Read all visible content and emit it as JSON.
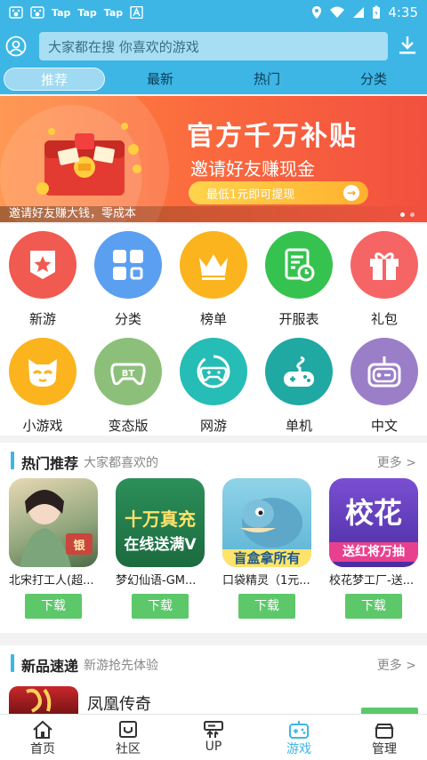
{
  "status_bar": {
    "tap_labels": [
      "Tap",
      "Tap",
      "Tap"
    ],
    "time": "4:35"
  },
  "header": {
    "search_placeholder": "大家都在搜  你喜欢的游戏",
    "tabs": [
      "推荐",
      "最新",
      "热门",
      "分类"
    ],
    "active_tab": "推荐",
    "accent_color": "#3db6e6"
  },
  "banner": {
    "title": "官方千万补贴",
    "subtitle": "邀请好友赚现金",
    "button_label": "最低1元即可提现",
    "caption": "邀请好友赚大钱，零成本",
    "slide_count": 2
  },
  "categories": [
    {
      "label": "新游",
      "icon": "star-badge-icon",
      "color": "#f05a50"
    },
    {
      "label": "分类",
      "icon": "grid-icon",
      "color": "#5b9ff0"
    },
    {
      "label": "榜单",
      "icon": "crown-icon",
      "color": "#fbb31e"
    },
    {
      "label": "开服表",
      "icon": "server-schedule-icon",
      "color": "#36c24f"
    },
    {
      "label": "礼包",
      "icon": "gift-icon",
      "color": "#f56565"
    },
    {
      "label": "小游戏",
      "icon": "cat-face-icon",
      "color": "#fbb31e"
    },
    {
      "label": "变态版",
      "icon": "bt-gamepad-icon",
      "color": "#8cc07a"
    },
    {
      "label": "网游",
      "icon": "online-gamepad-icon",
      "color": "#26bdb6"
    },
    {
      "label": "单机",
      "icon": "joystick-icon",
      "color": "#1fa9a2"
    },
    {
      "label": "中文",
      "icon": "retro-console-icon",
      "color": "#9b7ec8"
    }
  ],
  "hot_section": {
    "title": "热门推荐",
    "subtitle": "大家都喜欢的",
    "more_label": "更多 >",
    "games": [
      {
        "name": "北宋打工人(超...",
        "button": "下载"
      },
      {
        "name": "梦幻仙语-GM...",
        "button": "下载",
        "icon_text_1": "十万真充",
        "icon_text_2": "在线送满V"
      },
      {
        "name": "口袋精灵（1元...",
        "button": "下载",
        "icon_text_1": "盲盒拿所有"
      },
      {
        "name": "校花梦工厂-送...",
        "button": "下载",
        "icon_text_1": "校花",
        "icon_text_2": "送红将万抽"
      }
    ]
  },
  "new_section": {
    "title": "新品速递",
    "subtitle": "新游抢先体验",
    "more_label": "更多 >",
    "first_game": "凤凰传奇"
  },
  "bottom_nav": {
    "items": [
      {
        "label": "首页",
        "icon": "home-icon"
      },
      {
        "label": "社区",
        "icon": "community-icon"
      },
      {
        "label": "UP",
        "icon": "up-icon"
      },
      {
        "label": "游戏",
        "icon": "game-icon"
      },
      {
        "label": "管理",
        "icon": "manage-icon"
      }
    ],
    "active": "游戏"
  }
}
